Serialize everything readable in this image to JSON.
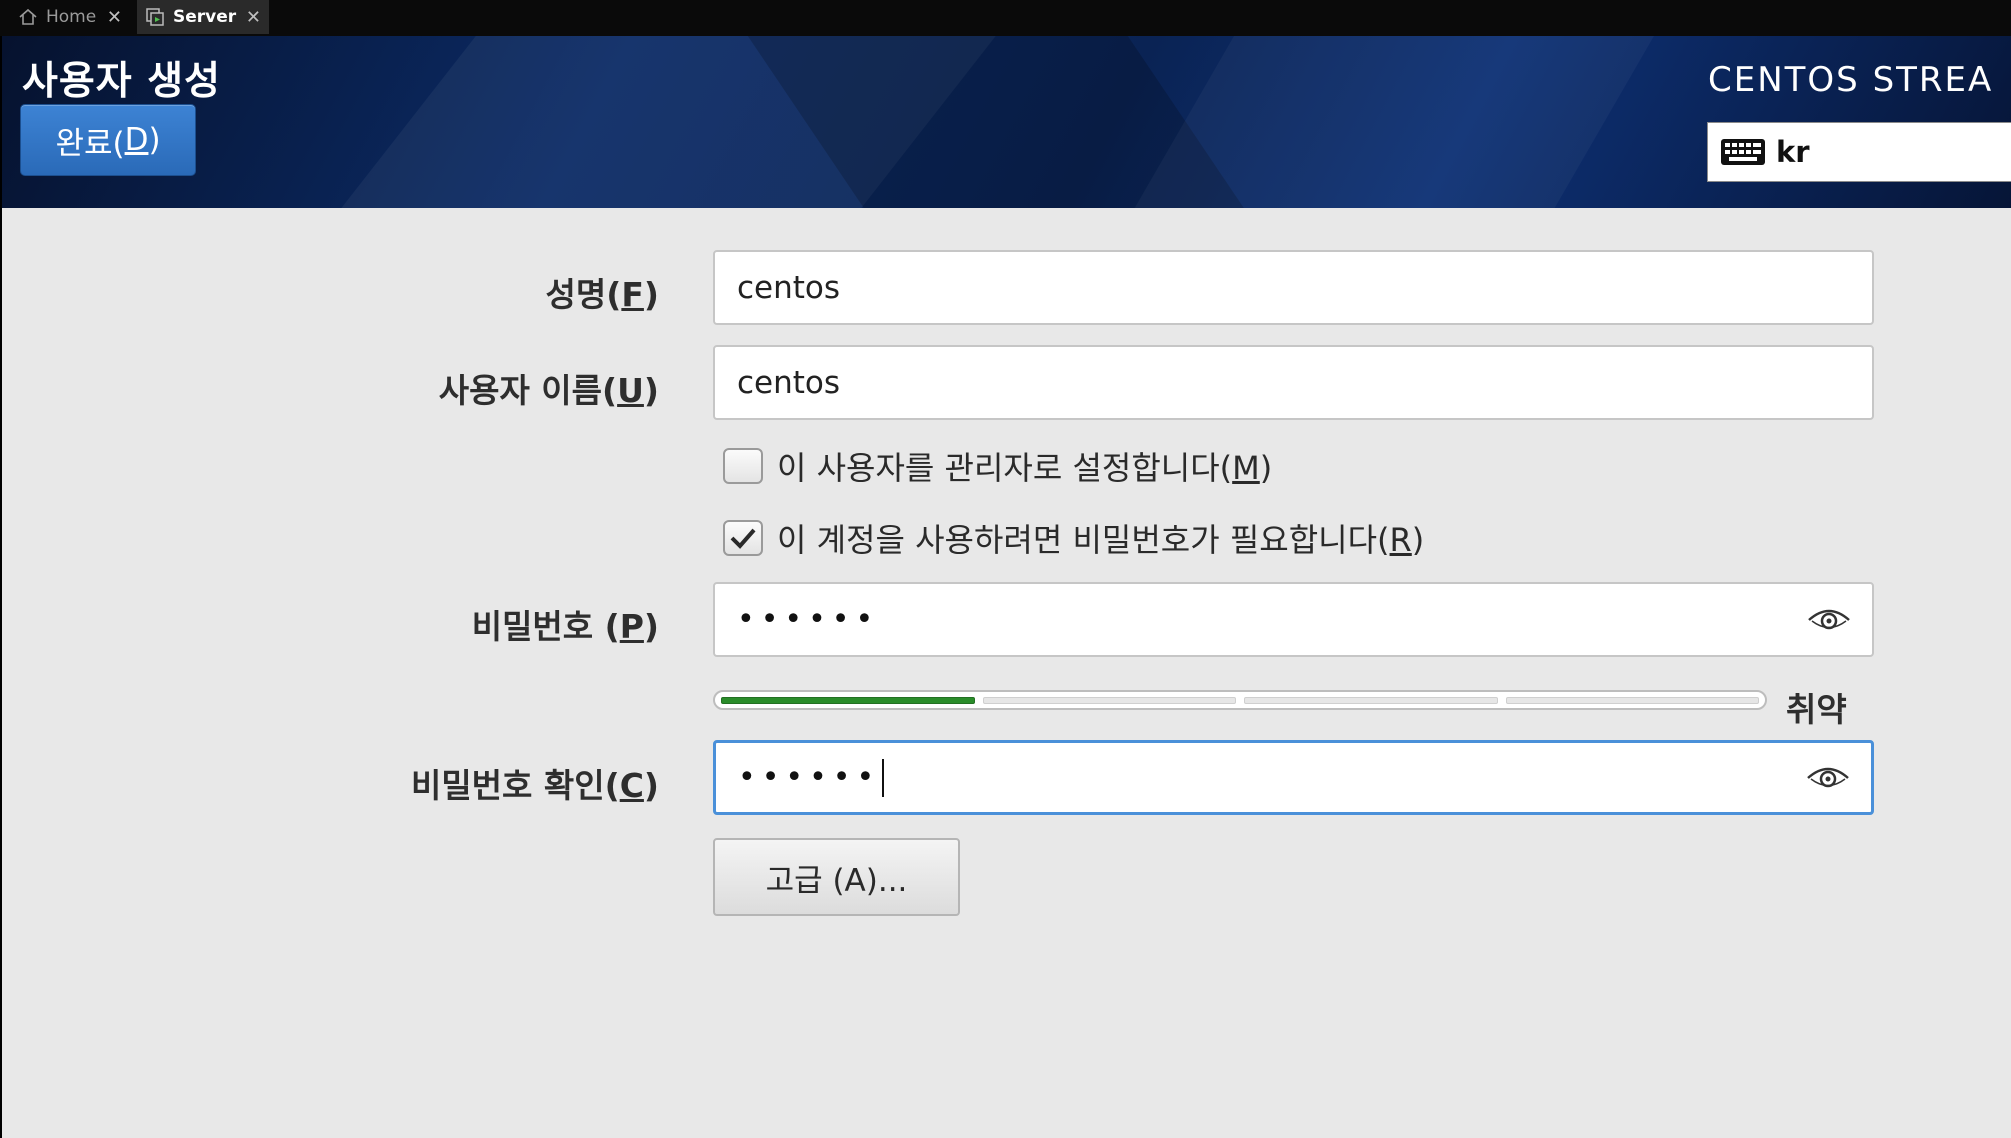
{
  "tabs": [
    {
      "label": "Home",
      "icon": "home-icon"
    },
    {
      "label": "Server",
      "icon": "vm-icon"
    }
  ],
  "header": {
    "title": "사용자 생성",
    "done_button": {
      "label": "완료(",
      "mnemonic": "D",
      "suffix": ")"
    },
    "product_name": "CENTOS STREA",
    "keyboard_layout": "kr"
  },
  "form": {
    "fullname": {
      "label": "성명(",
      "mnemonic": "F",
      "suffix": ")",
      "value": "centos"
    },
    "username": {
      "label": "사용자 이름(",
      "mnemonic": "U",
      "suffix": ")",
      "value": "centos"
    },
    "admin_checkbox": {
      "label": "이 사용자를 관리자로 설정합니다(",
      "mnemonic": "M",
      "suffix": ")",
      "checked": false
    },
    "require_password_checkbox": {
      "label": "이 계정을 사용하려면 비밀번호가 필요합니다(",
      "mnemonic": "R",
      "suffix": ")",
      "checked": true
    },
    "password": {
      "label": "비밀번호 (",
      "mnemonic": "P",
      "suffix": ")",
      "masked": "••••••"
    },
    "strength": {
      "level": 0.25,
      "text": "취약"
    },
    "confirm": {
      "label": "비밀번호 확인(",
      "mnemonic": "C",
      "suffix": ")",
      "masked": "••••••"
    },
    "advanced_button": "고급 (A)..."
  },
  "colors": {
    "accent": "#2a6ab8",
    "focus_border": "#4a90d9",
    "strength_fill": "#2a8c2a",
    "body_bg": "#e8e8e8"
  }
}
